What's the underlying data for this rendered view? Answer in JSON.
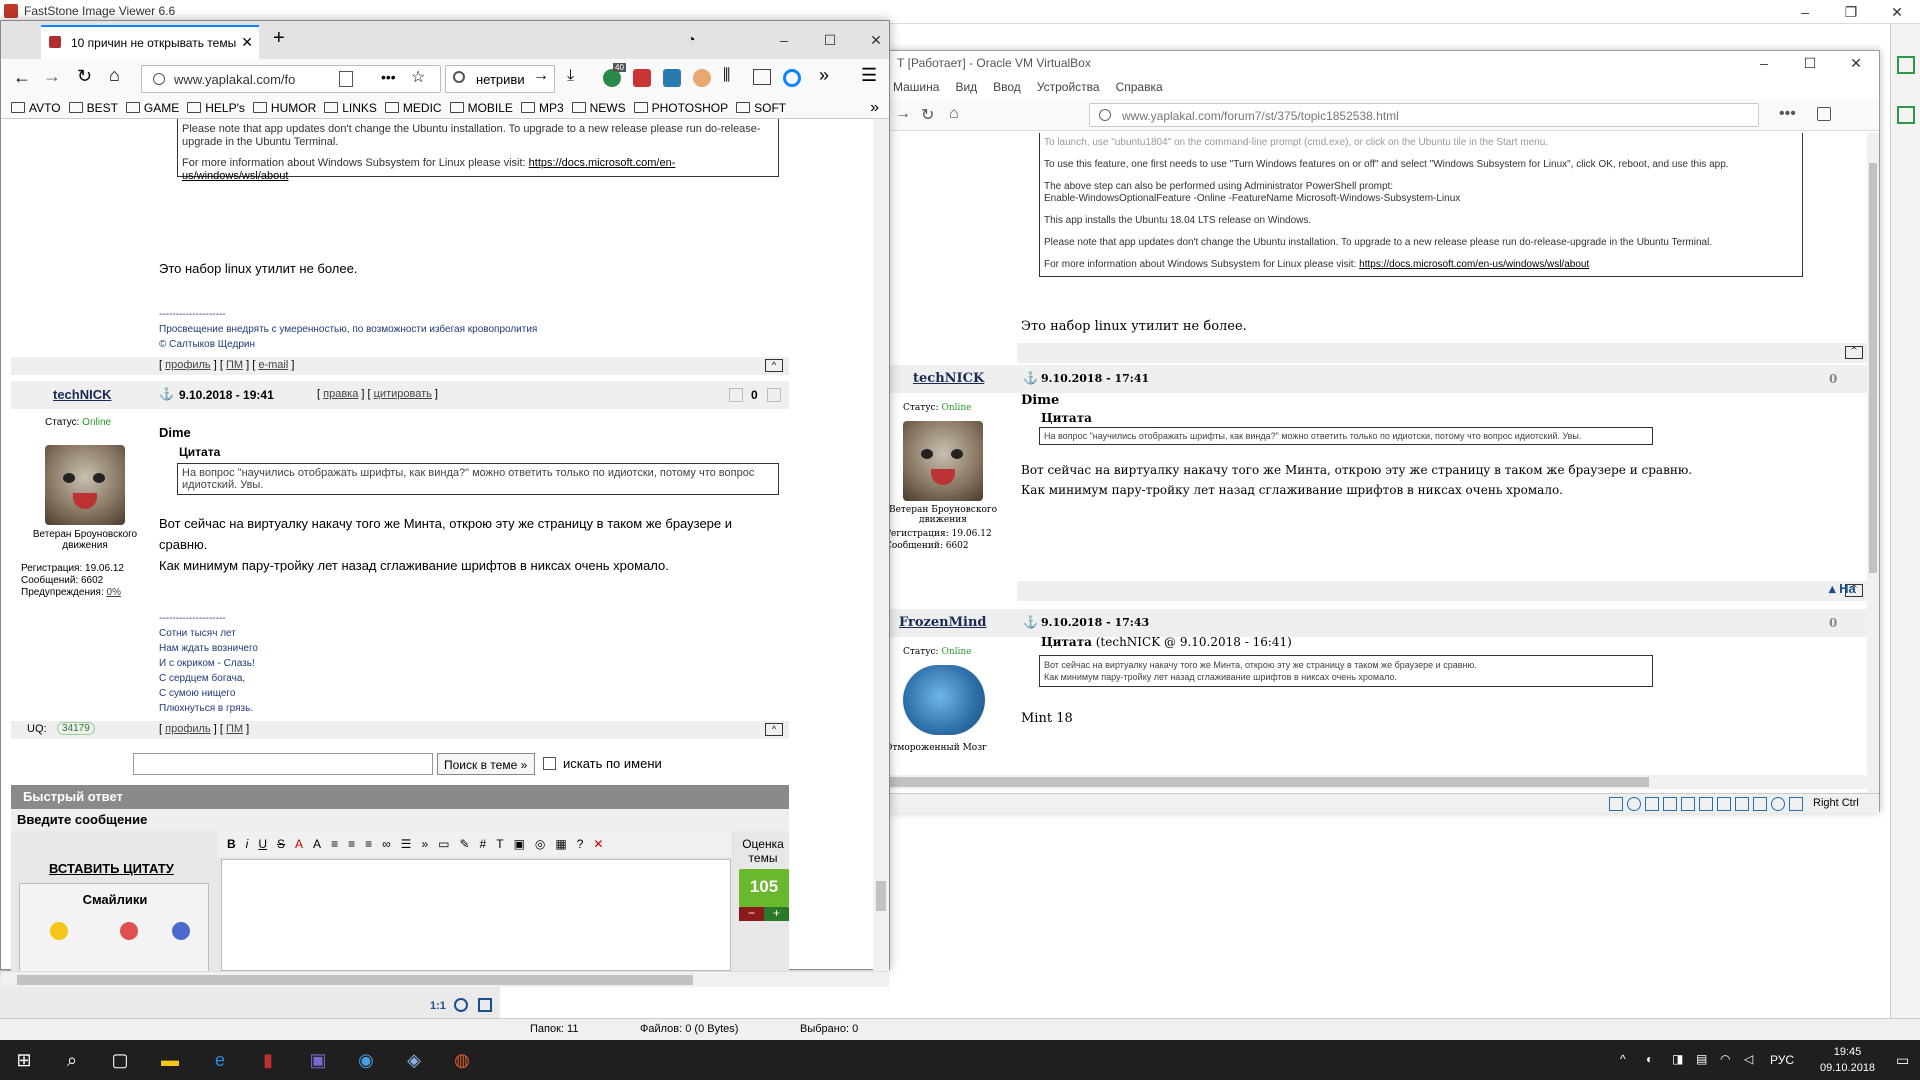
{
  "faststone": {
    "title": "FastStone Image Viewer 6.6",
    "status": {
      "folders": "Папок: 11",
      "files": "Файлов: 0 (0 Bytes)",
      "selected": "Выбрано: 0"
    },
    "zoom_label": "1:1"
  },
  "vbox": {
    "title": "Т [Работает] - Oracle VM VirtualBox",
    "menu": [
      "Машина",
      "Вид",
      "Ввод",
      "Устройства",
      "Справка"
    ],
    "url": "www.yaplakal.com/forum7/st/375/topic1852538.html",
    "status_right": "Right Ctrl",
    "content": {
      "top_lines": [
        "To launch, use \"ubuntu1804\" on the command-line prompt (cmd.exe), or click on the Ubuntu tile in the Start menu.",
        "To use this feature, one first needs to use \"Turn Windows features on or off\" and select \"Windows Subsystem for Linux\", click OK, reboot, and use this app.",
        "The above step can also be performed using Administrator PowerShell prompt:",
        "Enable-WindowsOptionalFeature -Online -FeatureName Microsoft-Windows-Subsystem-Linux",
        "This app installs the Ubuntu 18.04 LTS release on Windows.",
        "Please note that app updates don't change the Ubuntu installation. To upgrade to a new release please run do-release-upgrade in the Ubuntu Terminal.",
        "For more information about Windows Subsystem for Linux please visit:"
      ],
      "top_link": "https://docs.microsoft.com/en-us/windows/wsl/about",
      "after_quote": "Это набор linux утилит не более.",
      "post1": {
        "nick": "techNICK",
        "date": "9.10.2018 - 17:41",
        "rating": "0",
        "status_label": "Статус:",
        "status": "Online",
        "rank": "Ветеран Броуновского движения",
        "reg": "Регистрация: 19.06.12",
        "msgs": "Сообщений: 6602",
        "addressee": "Dime",
        "quote_title": "Цитата",
        "quote_text": "На вопрос \"научились отображать шрифты, как винда?\" можно ответить только по идиотски, потому что вопрос идиотский. Увы.",
        "line1": "Вот сейчас на виртуалку накачу того же Минта, открою эту же страницу в таком же браузере и сравню.",
        "line2": "Как минимум пару-тройку лет назад сглаживание шрифтов в никсах очень хромало."
      },
      "side_link": "На",
      "post2": {
        "nick": "FrozenMind",
        "date": "9.10.2018 - 17:43",
        "rating": "0",
        "status_label": "Статус:",
        "status": "Online",
        "rank": "Отмороженный Мозг",
        "quote_title": "Цитата",
        "quote_meta": "(techNICK @ 9.10.2018 - 16:41)",
        "quote_line1": "Вот сейчас на виртуалку накачу того же Минта, открою эту же страницу в таком же браузере и сравню.",
        "quote_line2": "Как минимум пару-тройку лет назад сглаживание шрифтов в никсах очень хромало.",
        "text": "Mint 18"
      }
    }
  },
  "firefox": {
    "tab_title": "10 причин не открывать темы",
    "url": "www.yaplakal.com/fo",
    "search_value": "нетриви",
    "badge_count": "40",
    "bookmarks": [
      "AVTO",
      "BEST",
      "GAME",
      "HELP's",
      "HUMOR",
      "LINKS",
      "MEDIC",
      "MOBILE",
      "MP3",
      "NEWS",
      "PHOTOSHOP",
      "SOFT"
    ],
    "content": {
      "upgrade_note": "Please note that app updates don't change the Ubuntu installation. To upgrade to a new release please run do-release-upgrade in the Ubuntu Terminal.",
      "more_info": "For more information about Windows Subsystem for Linux please visit:",
      "more_link": "https://docs.microsoft.com/en-us/windows/wsl/about",
      "after_quote": "Это набор linux утилит не более.",
      "sig_dashes": "--------------------",
      "sig1_line1": "Просвещение внедрять с умеренностью, по возможности избегая кровопролития",
      "sig1_line2": "© Салтыков Щедрин",
      "links1": {
        "profile": "профиль",
        "pm": "ПМ",
        "email": "e-mail"
      },
      "post": {
        "nick": "techNICK",
        "date": "9.10.2018 - 19:41",
        "edit": "правка",
        "cite": "цитировать",
        "rating": "0",
        "status_label": "Статус:",
        "status": "Online",
        "rank": "Ветеран Броуновского движения",
        "reg": "Регистрация: 19.06.12",
        "msgs": "Сообщений: 6602",
        "warn": "Предупреждения:",
        "warn_val": "0%",
        "addressee": "Dime",
        "quote_title": "Цитата",
        "quote_text": "На вопрос \"научились отображать шрифты, как винда?\" можно ответить только по идиотски, потому что вопрос идиотский. Увы.",
        "line1": "Вот сейчас на виртуалку накачу того же Минта, открою эту же страницу в таком же браузере и сравню.",
        "line2": "Как минимум пару-тройку лет назад сглаживание шрифтов в никсах очень хромало.",
        "sig": [
          "Сотни тысяч лет",
          "Нам ждать возничего",
          "И с окриком - Слазь!",
          "С сердцем богача,",
          "С сумою нищего",
          "Плюхнуться в грязь."
        ],
        "uq_label": "UQ:",
        "uq_value": "34179"
      },
      "links2": {
        "profile": "профиль",
        "pm": "ПМ"
      },
      "search_button": "Поиск в теме »",
      "search_by_name": "искать по имени",
      "quick_reply": "Быстрый ответ",
      "enter_message": "Введите сообщение",
      "insert_quote": "ВСТАВИТЬ ЦИТАТУ",
      "smileys": "Смайлики",
      "rating_label": "Оценка темы",
      "rating_value": "105"
    }
  },
  "taskbar": {
    "lang": "РУС",
    "time": "19:45",
    "date": "09.10.2018"
  }
}
